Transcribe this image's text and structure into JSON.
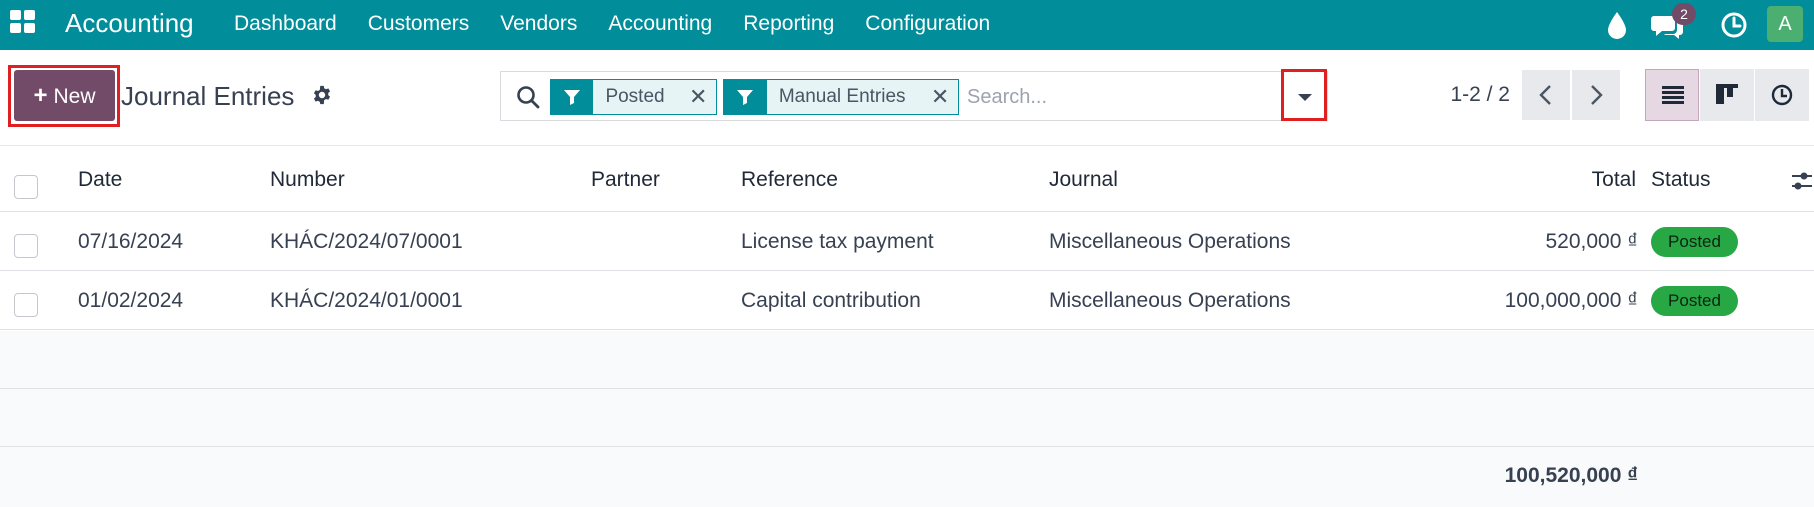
{
  "navbar": {
    "brand": "Accounting",
    "menu": [
      "Dashboard",
      "Customers",
      "Vendors",
      "Accounting",
      "Reporting",
      "Configuration"
    ],
    "chat_badge": "2",
    "avatar_letter": "A",
    "icons": [
      "apps-grid-icon",
      "water-drop-icon",
      "chat-icon",
      "clock-icon"
    ]
  },
  "control_panel": {
    "new_label": "New",
    "title": "Journal Entries",
    "facets": [
      {
        "label": "Posted"
      },
      {
        "label": "Manual Entries"
      }
    ],
    "search_placeholder": "Search...",
    "pager": "1-2 / 2"
  },
  "table": {
    "headers": {
      "date": "Date",
      "number": "Number",
      "partner": "Partner",
      "reference": "Reference",
      "journal": "Journal",
      "total": "Total",
      "status": "Status"
    },
    "rows": [
      {
        "date": "07/16/2024",
        "number": "KHÁC/2024/07/0001",
        "partner": "",
        "reference": "License tax payment",
        "journal": "Miscellaneous Operations",
        "total": "520,000 ₫",
        "status": "Posted"
      },
      {
        "date": "01/02/2024",
        "number": "KHÁC/2024/01/0001",
        "partner": "",
        "reference": "Capital contribution",
        "journal": "Miscellaneous Operations",
        "total": "100,000,000 ₫",
        "status": "Posted"
      }
    ],
    "grand_total": "100,520,000 ₫"
  },
  "colors": {
    "navbar": "#018d99",
    "primary_button": "#714b67",
    "status_posted": "#28a745",
    "highlight_box": "#e02020"
  }
}
